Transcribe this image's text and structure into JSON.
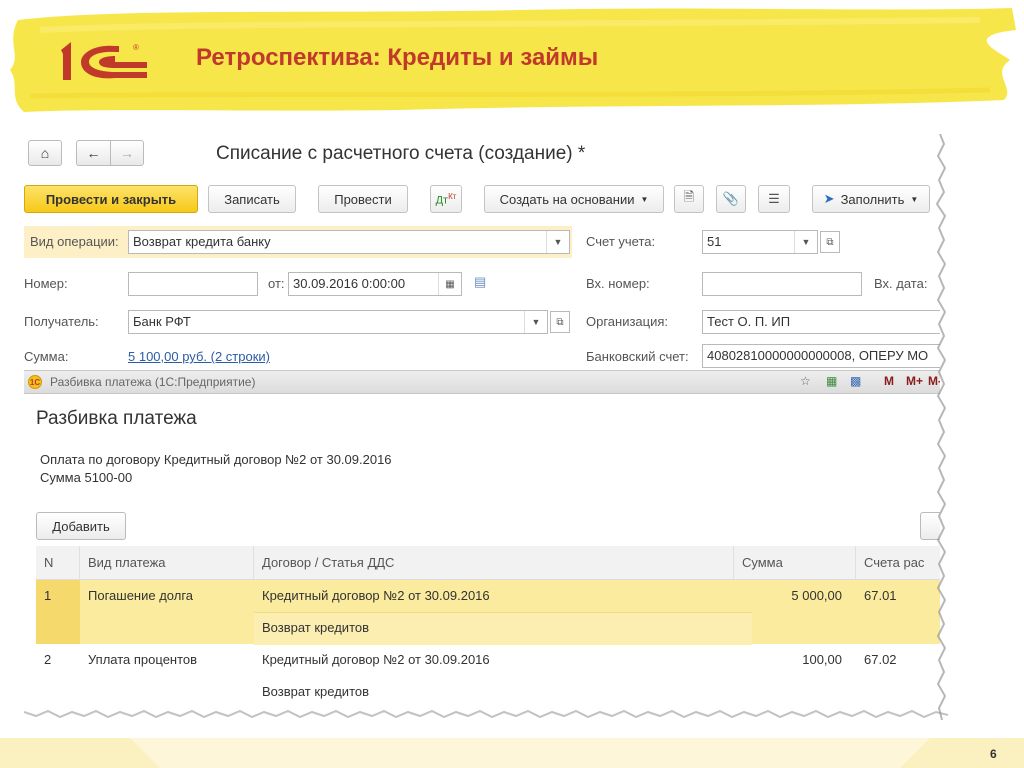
{
  "slide": {
    "title": "Ретроспектива: Кредиты и займы",
    "page_number": "6",
    "logo_text": "1С",
    "brand_color": "#c0392b",
    "highlight_color": "#f7e64a"
  },
  "form": {
    "nav_icons": [
      "home-icon",
      "back-arrow-icon",
      "forward-arrow-icon"
    ],
    "title": "Списание с расчетного счета (создание) *",
    "toolbar": {
      "post_and_close": "Провести и закрыть",
      "save": "Записать",
      "post": "Провести",
      "create_based_on": "Создать на основании",
      "fill": "Заполнить"
    },
    "fields": {
      "operation_type_label": "Вид операции:",
      "operation_type_value": "Возврат кредита банку",
      "account_label": "Счет учета:",
      "account_value": "51",
      "number_label": "Номер:",
      "number_value": "",
      "date_label": "от:",
      "date_value": "30.09.2016  0:00:00",
      "incoming_number_label": "Вх. номер:",
      "incoming_number_value": "",
      "incoming_date_label": "Вх. дата:",
      "recipient_label": "Получатель:",
      "recipient_value": "Банк РФТ",
      "organization_label": "Организация:",
      "organization_value": "Тест О. П. ИП",
      "amount_label": "Сумма:",
      "amount_value": "5 100,00 руб. (2 строки)",
      "bank_account_label": "Банковский счет:",
      "bank_account_value": "40802810000000000008, ОПЕРУ МО"
    }
  },
  "dialog": {
    "window_title": "Разбивка платежа (1С:Предприятие)",
    "titlebar_buttons": [
      "М",
      "М+",
      "М-"
    ],
    "heading": "Разбивка платежа",
    "info_line1": "Оплата по договору Кредитный договор №2 от 30.09.2016",
    "info_line2": "Сумма 5100-00",
    "add_button": "Добавить",
    "table": {
      "columns": [
        "N",
        "Вид платежа",
        "Договор / Статья ДДС",
        "Сумма",
        "Счета рас"
      ],
      "rows": [
        {
          "n": "1",
          "payment_type": "Погашение долга",
          "contract": "Кредитный договор №2 от 30.09.2016",
          "article": "Возврат кредитов",
          "amount": "5 000,00",
          "account": "67.01"
        },
        {
          "n": "2",
          "payment_type": "Уплата процентов",
          "contract": "Кредитный договор №2 от 30.09.2016",
          "article": "Возврат кредитов",
          "amount": "100,00",
          "account": "67.02"
        }
      ]
    }
  }
}
